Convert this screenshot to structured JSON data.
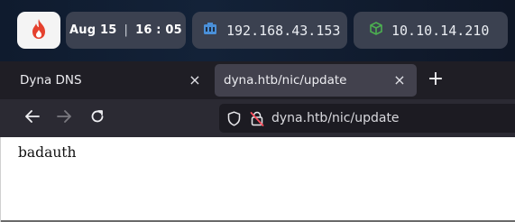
{
  "panel": {
    "date": "Aug 15",
    "time": "16 : 05",
    "separator": "|",
    "ip_local": "192.168.43.153",
    "ip_vpn": "10.10.14.210",
    "icons": [
      "app-flame-icon",
      "network-icon",
      "vpn-cube-icon"
    ],
    "colors": {
      "chip": "#3b4150",
      "flame": "#e5412e",
      "network": "#4a90d9",
      "vpn": "#4caf50"
    }
  },
  "browser": {
    "tabs": [
      {
        "label": "Dyna DNS",
        "active": false
      },
      {
        "label": "dyna.htb/nic/update",
        "active": true
      }
    ],
    "new_tab_label": "+",
    "close_label": "×",
    "url": "dyna.htb/nic/update",
    "nav_icons": [
      "back-arrow-icon",
      "forward-arrow-icon",
      "reload-icon",
      "shield-icon",
      "insecure-lock-icon"
    ]
  },
  "page": {
    "body_text": "badauth"
  }
}
